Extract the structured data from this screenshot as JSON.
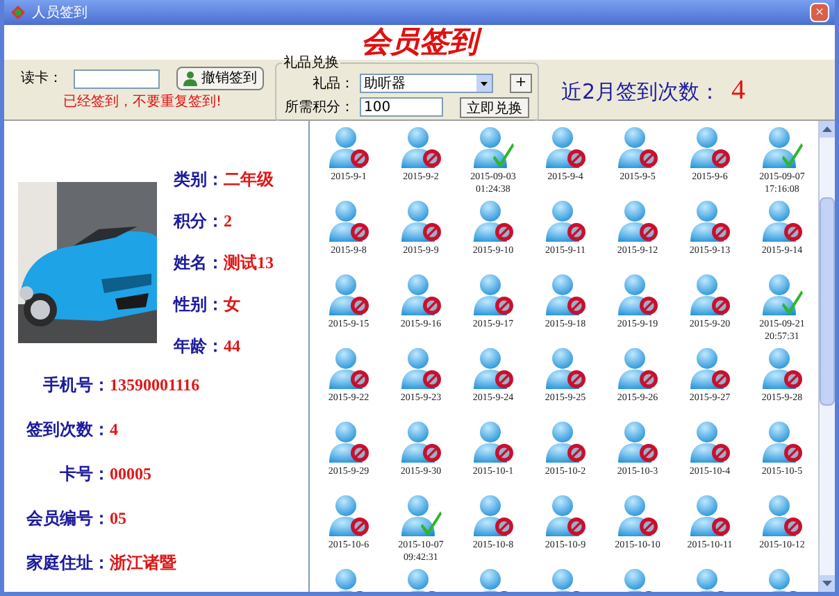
{
  "window": {
    "title": "人员签到",
    "close": "×"
  },
  "header": {
    "title": "会员签到"
  },
  "card_reader": {
    "label": "读卡：",
    "button": "撤销签到",
    "message": "已经签到，不要重复签到!"
  },
  "gift_exchange": {
    "legend": "礼品兑换",
    "gift_label": "礼品：",
    "gift_value": "助听器",
    "add_button": "+",
    "points_label": "所需积分：",
    "points_value": "100",
    "exchange_button": "立即兑换"
  },
  "summary": {
    "label": "近2月签到次数：",
    "value": "4"
  },
  "member": {
    "side_fields": [
      {
        "label": "类别：",
        "value": "二年级"
      },
      {
        "label": "积分：",
        "value": "2"
      },
      {
        "label": "姓名：",
        "value": "测试13"
      },
      {
        "label": "性别：",
        "value": "女"
      },
      {
        "label": "年龄：",
        "value": "44"
      }
    ],
    "fields": [
      {
        "label": "手机号：",
        "value": "13590001116"
      },
      {
        "label": "签到次数：",
        "value": "4"
      },
      {
        "label": "卡号：",
        "value": "00005"
      },
      {
        "label": "会员编号：",
        "value": "05"
      },
      {
        "label": "家庭住址：",
        "value": "浙江诸暨"
      }
    ]
  },
  "days": [
    {
      "date": "2015-9-1",
      "signed_in": false
    },
    {
      "date": "2015-9-2",
      "signed_in": false
    },
    {
      "date": "2015-09-03",
      "time": "01:24:38",
      "signed_in": true
    },
    {
      "date": "2015-9-4",
      "signed_in": false
    },
    {
      "date": "2015-9-5",
      "signed_in": false
    },
    {
      "date": "2015-9-6",
      "signed_in": false
    },
    {
      "date": "2015-09-07",
      "time": "17:16:08",
      "signed_in": true
    },
    {
      "date": "2015-9-8",
      "signed_in": false
    },
    {
      "date": "2015-9-9",
      "signed_in": false
    },
    {
      "date": "2015-9-10",
      "signed_in": false
    },
    {
      "date": "2015-9-11",
      "signed_in": false
    },
    {
      "date": "2015-9-12",
      "signed_in": false
    },
    {
      "date": "2015-9-13",
      "signed_in": false
    },
    {
      "date": "2015-9-14",
      "signed_in": false
    },
    {
      "date": "2015-9-15",
      "signed_in": false
    },
    {
      "date": "2015-9-16",
      "signed_in": false
    },
    {
      "date": "2015-9-17",
      "signed_in": false
    },
    {
      "date": "2015-9-18",
      "signed_in": false
    },
    {
      "date": "2015-9-19",
      "signed_in": false
    },
    {
      "date": "2015-9-20",
      "signed_in": false
    },
    {
      "date": "2015-09-21",
      "time": "20:57:31",
      "signed_in": true
    },
    {
      "date": "2015-9-22",
      "signed_in": false
    },
    {
      "date": "2015-9-23",
      "signed_in": false
    },
    {
      "date": "2015-9-24",
      "signed_in": false
    },
    {
      "date": "2015-9-25",
      "signed_in": false
    },
    {
      "date": "2015-9-26",
      "signed_in": false
    },
    {
      "date": "2015-9-27",
      "signed_in": false
    },
    {
      "date": "2015-9-28",
      "signed_in": false
    },
    {
      "date": "2015-9-29",
      "signed_in": false
    },
    {
      "date": "2015-9-30",
      "signed_in": false
    },
    {
      "date": "2015-10-1",
      "signed_in": false
    },
    {
      "date": "2015-10-2",
      "signed_in": false
    },
    {
      "date": "2015-10-3",
      "signed_in": false
    },
    {
      "date": "2015-10-4",
      "signed_in": false
    },
    {
      "date": "2015-10-5",
      "signed_in": false
    },
    {
      "date": "2015-10-6",
      "signed_in": false
    },
    {
      "date": "2015-10-07",
      "time": "09:42:31",
      "signed_in": true
    },
    {
      "date": "2015-10-8",
      "signed_in": false
    },
    {
      "date": "2015-10-9",
      "signed_in": false
    },
    {
      "date": "2015-10-10",
      "signed_in": false
    },
    {
      "date": "2015-10-11",
      "signed_in": false
    },
    {
      "date": "2015-10-12",
      "signed_in": false
    },
    {
      "signed_in": false
    },
    {
      "signed_in": false
    },
    {
      "signed_in": false
    },
    {
      "signed_in": false
    },
    {
      "signed_in": false
    },
    {
      "signed_in": false
    },
    {
      "signed_in": false
    }
  ]
}
